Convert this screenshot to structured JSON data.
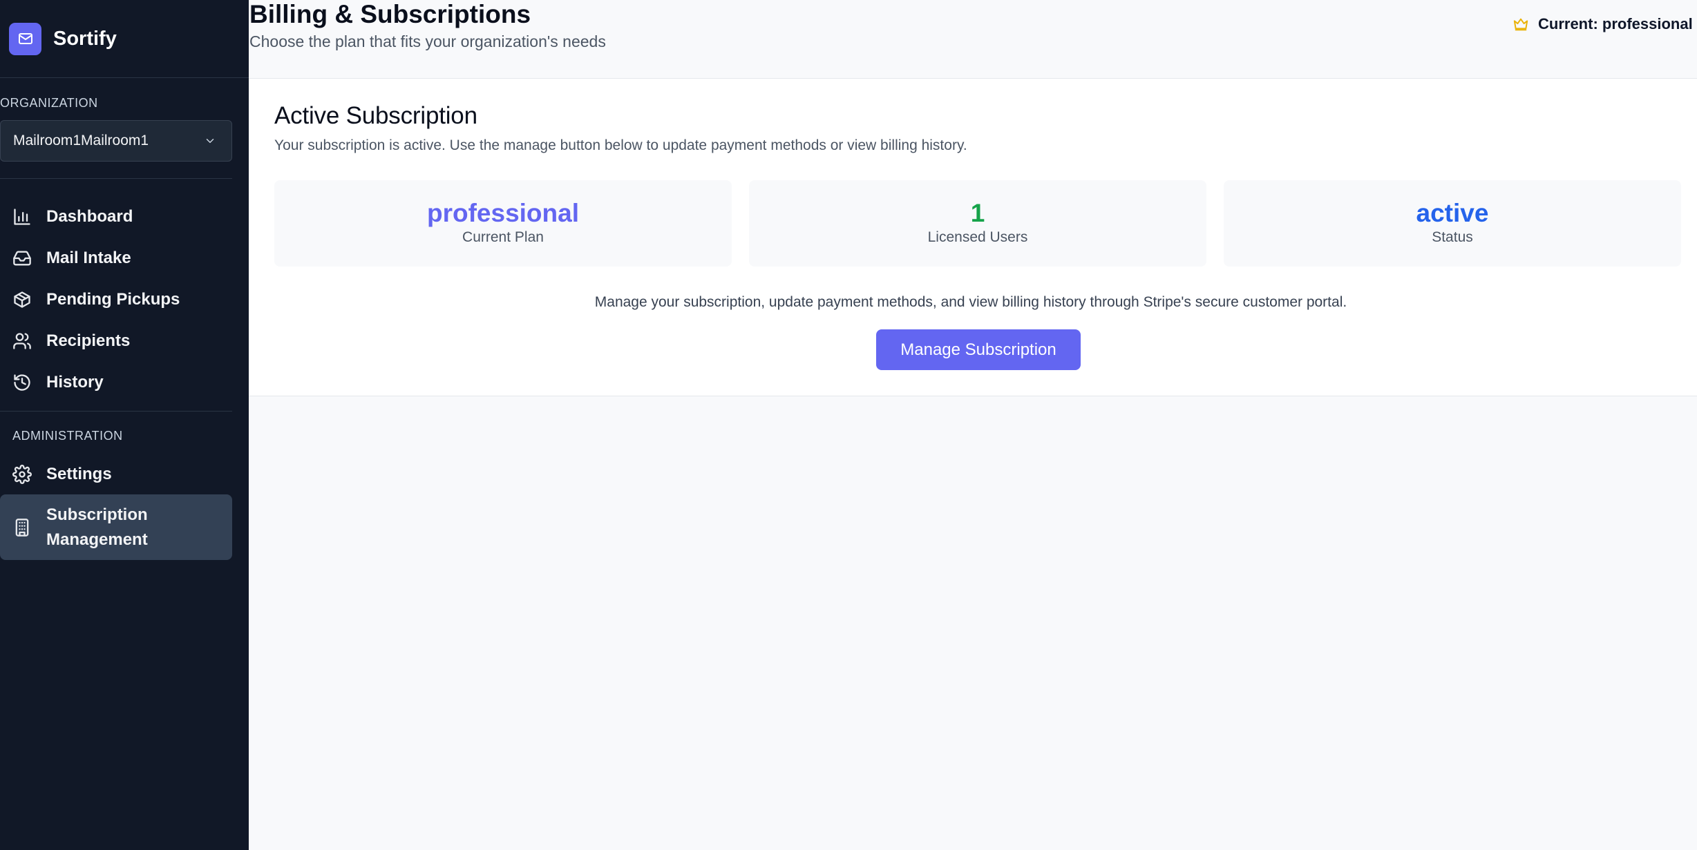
{
  "app": {
    "name": "Sortify"
  },
  "sidebar": {
    "org_label": "ORGANIZATION",
    "org_selected": "Mailroom1Mailroom1",
    "items": [
      {
        "label": "Dashboard",
        "icon": "bar-chart-icon"
      },
      {
        "label": "Mail Intake",
        "icon": "inbox-icon"
      },
      {
        "label": "Pending Pickups",
        "icon": "package-icon"
      },
      {
        "label": "Recipients",
        "icon": "users-icon"
      },
      {
        "label": "History",
        "icon": "history-icon"
      }
    ],
    "admin_label": "ADMINISTRATION",
    "admin_items": [
      {
        "label": "Settings",
        "icon": "gear-icon"
      },
      {
        "label": "Subscription Management",
        "icon": "building-icon",
        "active": true
      }
    ]
  },
  "header": {
    "title": "Billing & Subscriptions",
    "subtitle": "Choose the plan that fits your organization's needs",
    "current_plan": "Current: professional Plan"
  },
  "subscription": {
    "title": "Active Subscription",
    "description": "Your subscription is active. Use the manage button below to update payment methods or view billing history.",
    "stats": [
      {
        "value": "professional",
        "label": "Current Plan",
        "color": "#6366f1"
      },
      {
        "value": "1",
        "label": "Licensed Users",
        "color": "#16a34a"
      },
      {
        "value": "active",
        "label": "Status",
        "color": "#2563eb"
      }
    ],
    "portal_note": "Manage your subscription, update payment methods, and view billing history through Stripe's secure customer portal.",
    "manage_button": "Manage Subscription"
  },
  "colors": {
    "sidebar_bg": "#111827",
    "accent": "#6366f1",
    "crown": "#eab308"
  }
}
